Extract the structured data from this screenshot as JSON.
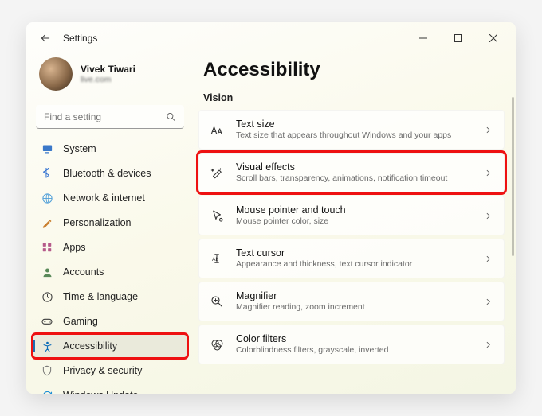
{
  "window": {
    "title": "Settings"
  },
  "profile": {
    "name": "Vivek Tiwari",
    "email": "live.com"
  },
  "search": {
    "placeholder": "Find a setting"
  },
  "sidebar": {
    "items": [
      {
        "icon": "system",
        "label": "System",
        "color": "#3a78c9"
      },
      {
        "icon": "bluetooth",
        "label": "Bluetooth & devices",
        "color": "#2f6fd0"
      },
      {
        "icon": "network",
        "label": "Network & internet",
        "color": "#4e9ed8"
      },
      {
        "icon": "personalize",
        "label": "Personalization",
        "color": "#c97f2e"
      },
      {
        "icon": "apps",
        "label": "Apps",
        "color": "#b55a8a"
      },
      {
        "icon": "accounts",
        "label": "Accounts",
        "color": "#5a8a5a"
      },
      {
        "icon": "time",
        "label": "Time & language",
        "color": "#3a3a3a"
      },
      {
        "icon": "gaming",
        "label": "Gaming",
        "color": "#3a3a3a"
      },
      {
        "icon": "accessibility",
        "label": "Accessibility",
        "color": "#0b6bb8",
        "active": true,
        "highlighted": true
      },
      {
        "icon": "privacy",
        "label": "Privacy & security",
        "color": "#6a6a6a"
      },
      {
        "icon": "update",
        "label": "Windows Update",
        "color": "#1f8fd6"
      }
    ]
  },
  "main": {
    "heading": "Accessibility",
    "section": "Vision",
    "cards": [
      {
        "icon": "text-size",
        "title": "Text size",
        "sub": "Text size that appears throughout Windows and your apps"
      },
      {
        "icon": "effects",
        "title": "Visual effects",
        "sub": "Scroll bars, transparency, animations, notification timeout",
        "highlighted": true
      },
      {
        "icon": "mouse",
        "title": "Mouse pointer and touch",
        "sub": "Mouse pointer color, size"
      },
      {
        "icon": "cursor",
        "title": "Text cursor",
        "sub": "Appearance and thickness, text cursor indicator"
      },
      {
        "icon": "magnifier",
        "title": "Magnifier",
        "sub": "Magnifier reading, zoom increment"
      },
      {
        "icon": "filters",
        "title": "Color filters",
        "sub": "Colorblindness filters, grayscale, inverted"
      }
    ]
  }
}
